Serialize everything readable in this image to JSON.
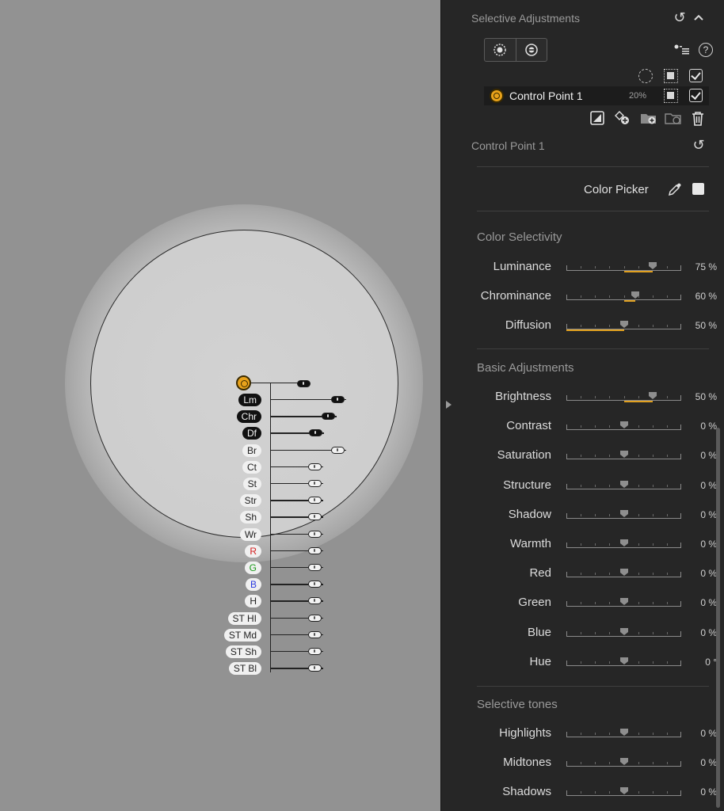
{
  "canvas": {
    "control_point": {
      "labels": [
        {
          "text": "Lm",
          "active": true
        },
        {
          "text": "Chr",
          "active": true
        },
        {
          "text": "Df",
          "active": true
        },
        {
          "text": "Br",
          "active": false
        },
        {
          "text": "Ct",
          "active": false
        },
        {
          "text": "St",
          "active": false
        },
        {
          "text": "Str",
          "active": false
        },
        {
          "text": "Sh",
          "active": false
        },
        {
          "text": "Wr",
          "active": false
        },
        {
          "text": "R",
          "active": false,
          "color": "red"
        },
        {
          "text": "G",
          "active": false,
          "color": "green"
        },
        {
          "text": "B",
          "active": false,
          "color": "blue"
        },
        {
          "text": "H",
          "active": false
        },
        {
          "text": "ST HI",
          "active": false
        },
        {
          "text": "ST Md",
          "active": false
        },
        {
          "text": "ST Sh",
          "active": false
        },
        {
          "text": "ST Bl",
          "active": false
        }
      ]
    }
  },
  "panel": {
    "section_title": "Selective Adjustments",
    "icons": {
      "reset": "↺",
      "collapse": "⌃",
      "help": "?",
      "eyedropper": "eyedropper-icon",
      "trash": "trash-icon"
    },
    "control_point_list": {
      "name": "Control Point 1",
      "opacity": "20%"
    },
    "current_point_title": "Control Point 1",
    "color_picker_label": "Color Picker",
    "groups": [
      {
        "title": "Color Selectivity",
        "sliders": [
          {
            "label": "Luminance",
            "value_text": "75 %",
            "value": 75,
            "fill_from": 50
          },
          {
            "label": "Chrominance",
            "value_text": "60 %",
            "value": 60,
            "fill_from": 50
          },
          {
            "label": "Diffusion",
            "value_text": "50 %",
            "value": 50,
            "fill_from": 0
          }
        ]
      },
      {
        "title": "Basic Adjustments",
        "sliders": [
          {
            "label": "Brightness",
            "value_text": "50 %",
            "value": 75,
            "fill_from": 50
          },
          {
            "label": "Contrast",
            "value_text": "0 %",
            "value": 50,
            "fill_from": 50
          },
          {
            "label": "Saturation",
            "value_text": "0 %",
            "value": 50,
            "fill_from": 50
          },
          {
            "label": "Structure",
            "value_text": "0 %",
            "value": 50,
            "fill_from": 50
          },
          {
            "label": "Shadow",
            "value_text": "0 %",
            "value": 50,
            "fill_from": 50
          },
          {
            "label": "Warmth",
            "value_text": "0 %",
            "value": 50,
            "fill_from": 50
          },
          {
            "label": "Red",
            "value_text": "0 %",
            "value": 50,
            "fill_from": 50
          },
          {
            "label": "Green",
            "value_text": "0 %",
            "value": 50,
            "fill_from": 50
          },
          {
            "label": "Blue",
            "value_text": "0 %",
            "value": 50,
            "fill_from": 50
          },
          {
            "label": "Hue",
            "value_text": "0 °",
            "value": 50,
            "fill_from": 50
          }
        ]
      },
      {
        "title": "Selective tones",
        "sliders": [
          {
            "label": "Highlights",
            "value_text": "0 %",
            "value": 50,
            "fill_from": 50
          },
          {
            "label": "Midtones",
            "value_text": "0 %",
            "value": 50,
            "fill_from": 50
          },
          {
            "label": "Shadows",
            "value_text": "0 %",
            "value": 50,
            "fill_from": 50
          }
        ]
      }
    ],
    "colors": {
      "accent": "#e0a020",
      "panel_bg": "#262626",
      "canvas_bg": "#929292"
    }
  }
}
